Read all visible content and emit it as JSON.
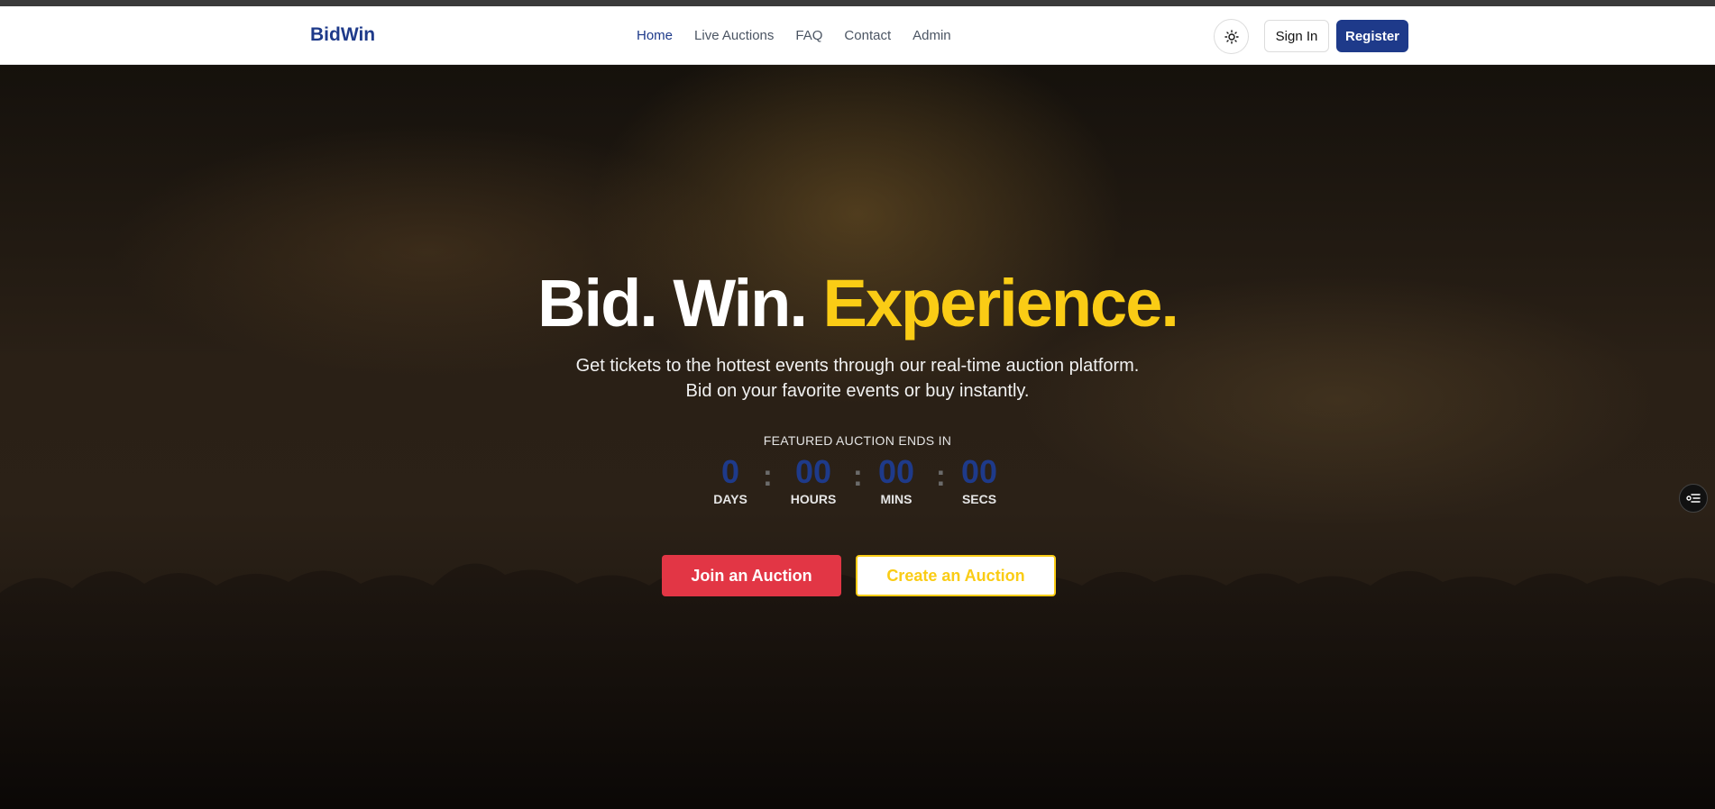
{
  "brand": {
    "name": "BidWin"
  },
  "nav": {
    "links": [
      {
        "label": "Home"
      },
      {
        "label": "Live Auctions"
      },
      {
        "label": "FAQ"
      },
      {
        "label": "Contact"
      },
      {
        "label": "Admin"
      }
    ],
    "active": "Home",
    "theme_toggle_icon": "sun-icon",
    "signin_label": "Sign In",
    "register_label": "Register"
  },
  "hero": {
    "headline_part1": "Bid. Win.",
    "headline_accent": "Experience.",
    "subtitle_line1": "Get tickets to the hottest events through our real-time auction platform.",
    "subtitle_line2": "Bid on your favorite events or buy instantly.",
    "countdown_label": "FEATURED AUCTION ENDS IN",
    "countdown": {
      "days": "0",
      "hours": "00",
      "mins": "00",
      "secs": "00",
      "days_label": "DAYS",
      "hours_label": "HOURS",
      "mins_label": "MINS",
      "secs_label": "SECS"
    },
    "join_label": "Join an Auction",
    "create_label": "Create an Auction"
  },
  "side_widget_icon": "settings-toggle-icon",
  "colors": {
    "brand_blue": "#1e3a8a",
    "accent_yellow": "#facc15",
    "join_red": "#e23645"
  }
}
